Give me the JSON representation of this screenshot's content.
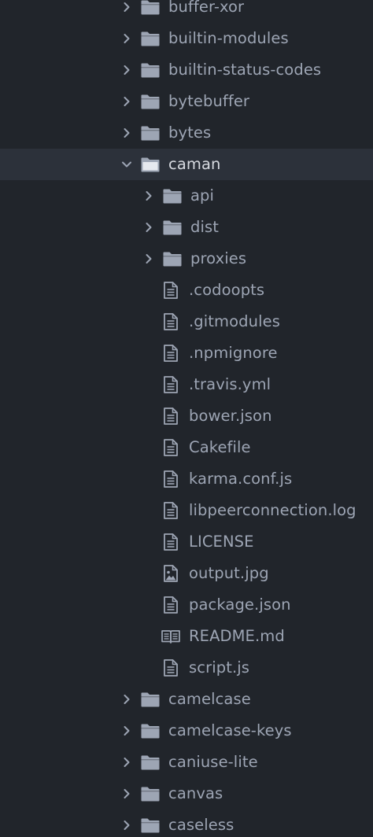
{
  "tree": {
    "items": [
      {
        "label": "buffer-xor",
        "type": "folder",
        "expanded": false,
        "depth": 0,
        "selected": false,
        "icon": "folder-icon"
      },
      {
        "label": "builtin-modules",
        "type": "folder",
        "expanded": false,
        "depth": 0,
        "selected": false,
        "icon": "folder-icon"
      },
      {
        "label": "builtin-status-codes",
        "type": "folder",
        "expanded": false,
        "depth": 0,
        "selected": false,
        "icon": "folder-icon"
      },
      {
        "label": "bytebuffer",
        "type": "folder",
        "expanded": false,
        "depth": 0,
        "selected": false,
        "icon": "folder-icon"
      },
      {
        "label": "bytes",
        "type": "folder",
        "expanded": false,
        "depth": 0,
        "selected": false,
        "icon": "folder-icon"
      },
      {
        "label": "caman",
        "type": "folder",
        "expanded": true,
        "depth": 0,
        "selected": true,
        "icon": "folder-open-icon"
      },
      {
        "label": "api",
        "type": "folder",
        "expanded": false,
        "depth": 1,
        "selected": false,
        "icon": "folder-icon"
      },
      {
        "label": "dist",
        "type": "folder",
        "expanded": false,
        "depth": 1,
        "selected": false,
        "icon": "folder-icon"
      },
      {
        "label": "proxies",
        "type": "folder",
        "expanded": false,
        "depth": 1,
        "selected": false,
        "icon": "folder-icon"
      },
      {
        "label": ".codoopts",
        "type": "file",
        "depth": 1,
        "selected": false,
        "icon": "file-text-icon"
      },
      {
        "label": ".gitmodules",
        "type": "file",
        "depth": 1,
        "selected": false,
        "icon": "file-text-icon"
      },
      {
        "label": ".npmignore",
        "type": "file",
        "depth": 1,
        "selected": false,
        "icon": "file-text-icon"
      },
      {
        "label": ".travis.yml",
        "type": "file",
        "depth": 1,
        "selected": false,
        "icon": "file-text-icon"
      },
      {
        "label": "bower.json",
        "type": "file",
        "depth": 1,
        "selected": false,
        "icon": "file-text-icon"
      },
      {
        "label": "Cakefile",
        "type": "file",
        "depth": 1,
        "selected": false,
        "icon": "file-text-icon"
      },
      {
        "label": "karma.conf.js",
        "type": "file",
        "depth": 1,
        "selected": false,
        "icon": "file-text-icon"
      },
      {
        "label": "libpeerconnection.log",
        "type": "file",
        "depth": 1,
        "selected": false,
        "icon": "file-text-icon"
      },
      {
        "label": "LICENSE",
        "type": "file",
        "depth": 1,
        "selected": false,
        "icon": "file-text-icon"
      },
      {
        "label": "output.jpg",
        "type": "file",
        "depth": 1,
        "selected": false,
        "icon": "file-image-icon"
      },
      {
        "label": "package.json",
        "type": "file",
        "depth": 1,
        "selected": false,
        "icon": "file-text-icon"
      },
      {
        "label": "README.md",
        "type": "file",
        "depth": 1,
        "selected": false,
        "icon": "book-icon"
      },
      {
        "label": "script.js",
        "type": "file",
        "depth": 1,
        "selected": false,
        "icon": "file-text-icon"
      },
      {
        "label": "camelcase",
        "type": "folder",
        "expanded": false,
        "depth": 0,
        "selected": false,
        "icon": "folder-icon"
      },
      {
        "label": "camelcase-keys",
        "type": "folder",
        "expanded": false,
        "depth": 0,
        "selected": false,
        "icon": "folder-icon"
      },
      {
        "label": "caniuse-lite",
        "type": "folder",
        "expanded": false,
        "depth": 0,
        "selected": false,
        "icon": "folder-icon"
      },
      {
        "label": "canvas",
        "type": "folder",
        "expanded": false,
        "depth": 0,
        "selected": false,
        "icon": "folder-icon"
      },
      {
        "label": "caseless",
        "type": "folder",
        "expanded": false,
        "depth": 0,
        "selected": false,
        "icon": "folder-icon"
      }
    ]
  },
  "colors": {
    "background": "#21252b",
    "selected_row": "#2c313a",
    "text": "#9da5b4",
    "icon": "#9da5b4"
  }
}
